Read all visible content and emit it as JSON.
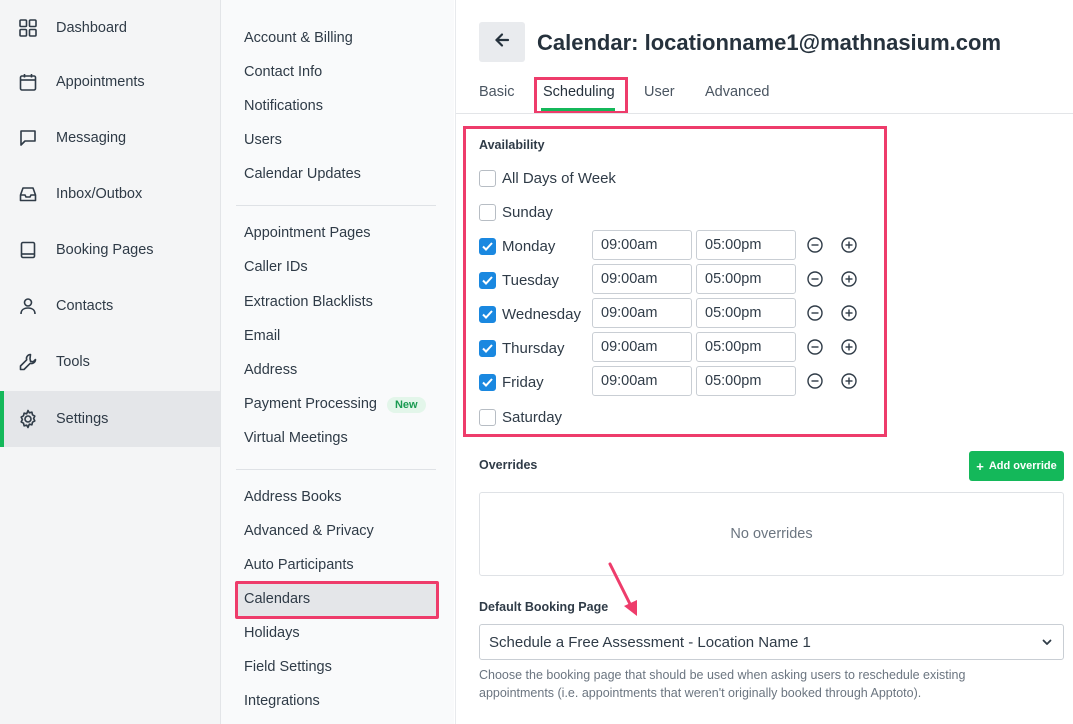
{
  "colors": {
    "accent": "#14b85a",
    "highlight": "#ee3c6b",
    "checkbox": "#1a88e0"
  },
  "leftnav": {
    "items": [
      {
        "label": "Dashboard",
        "icon": "grid-icon"
      },
      {
        "label": "Appointments",
        "icon": "calendar-icon"
      },
      {
        "label": "Messaging",
        "icon": "chat-icon"
      },
      {
        "label": "Inbox/Outbox",
        "icon": "inbox-icon"
      },
      {
        "label": "Booking Pages",
        "icon": "book-icon"
      },
      {
        "label": "Contacts",
        "icon": "person-icon"
      },
      {
        "label": "Tools",
        "icon": "wrench-icon"
      },
      {
        "label": "Settings",
        "icon": "gear-icon",
        "active": true
      }
    ]
  },
  "submenu": {
    "group1": [
      "Account & Billing",
      "Contact Info",
      "Notifications",
      "Users",
      "Calendar Updates"
    ],
    "group2": [
      "Appointment Pages",
      "Caller IDs",
      "Extraction Blacklists",
      "Email",
      "Address",
      "Payment Processing",
      "Virtual Meetings"
    ],
    "new_badge": "New",
    "group3": [
      "Address Books",
      "Advanced & Privacy",
      "Auto Participants",
      "Calendars",
      "Holidays",
      "Field Settings",
      "Integrations"
    ]
  },
  "header": {
    "title": "Calendar: locationname1@mathnasium.com"
  },
  "tabs": [
    "Basic",
    "Scheduling",
    "User",
    "Advanced"
  ],
  "availability": {
    "label": "Availability",
    "all_days": "All Days of Week",
    "days": [
      {
        "name": "Sunday",
        "checked": false
      },
      {
        "name": "Monday",
        "checked": true,
        "start": "09:00am",
        "end": "05:00pm"
      },
      {
        "name": "Tuesday",
        "checked": true,
        "start": "09:00am",
        "end": "05:00pm"
      },
      {
        "name": "Wednesday",
        "checked": true,
        "start": "09:00am",
        "end": "05:00pm"
      },
      {
        "name": "Thursday",
        "checked": true,
        "start": "09:00am",
        "end": "05:00pm"
      },
      {
        "name": "Friday",
        "checked": true,
        "start": "09:00am",
        "end": "05:00pm"
      },
      {
        "name": "Saturday",
        "checked": false
      }
    ]
  },
  "overrides": {
    "label": "Overrides",
    "add_button": "Add override",
    "empty_text": "No overrides"
  },
  "booking_page": {
    "label": "Default Booking Page",
    "selected": "Schedule a Free Assessment - Location Name 1",
    "help": "Choose the booking page that should be used when asking users to reschedule existing appointments (i.e. appointments that weren't originally booked through Apptoto)."
  }
}
